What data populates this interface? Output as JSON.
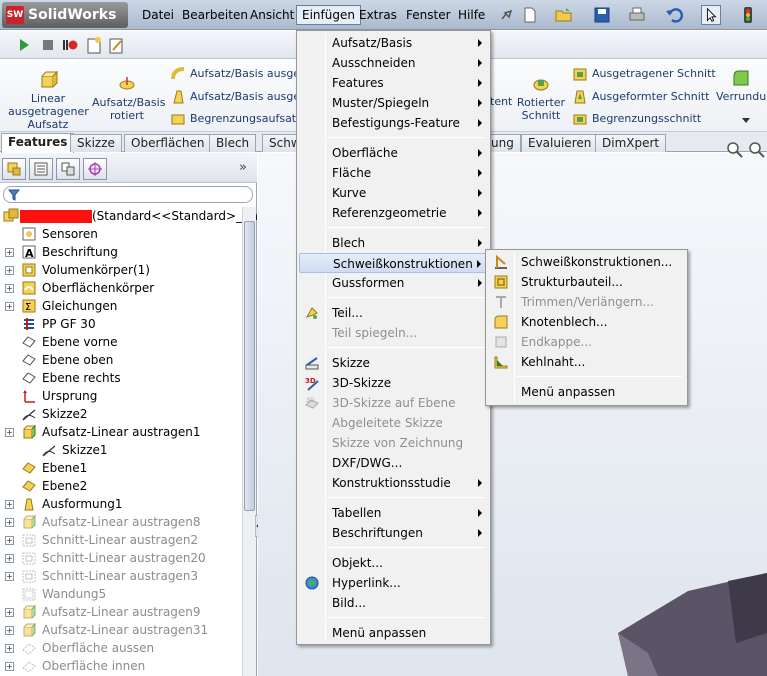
{
  "app": {
    "logo_text": "SolidWorks",
    "logo_mark": "SW"
  },
  "menubar": [
    "Datei",
    "Bearbeiten",
    "Ansicht",
    "Einfügen",
    "Extras",
    "Fenster",
    "Hilfe"
  ],
  "ribbon": {
    "big_buttons": [
      {
        "label": "Linear ausgetragener Aufsatz",
        "icon": "linear-extrude-boss-icon"
      },
      {
        "label": "Aufsatz/Basis rotiert",
        "icon": "revolve-boss-icon"
      },
      {
        "label": "Rotierter Schnitt",
        "icon": "revolve-cut-icon"
      },
      {
        "label": "Verrundung",
        "icon": "fillet-icon"
      }
    ],
    "small_buttons_left": [
      "Aufsatz/Basis ausgetr",
      "Aufsatz/Basis ausgefo",
      "Begrenzungsaufsatz/-"
    ],
    "small_buttons_right": [
      "Ausgetragener Schnitt",
      "Ausgeformter Schnitt",
      "Begrenzungsschnitt"
    ],
    "partial_label": "tent"
  },
  "tabs": [
    "Features",
    "Skizze",
    "Oberflächen",
    "Blech",
    "Schw",
    "ung",
    "Evaluieren",
    "DimXpert"
  ],
  "tree": {
    "root_label": "(Standard<<Standard>_Anz",
    "items": [
      {
        "label": "Sensoren",
        "icon": "sensor-icon",
        "expand": false,
        "dim": false
      },
      {
        "label": "Beschriftung",
        "icon": "annotation-icon",
        "expand": true,
        "dim": false
      },
      {
        "label": "Volumenkörper(1)",
        "icon": "solid-bodies-icon",
        "expand": true,
        "dim": false
      },
      {
        "label": "Oberflächenkörper",
        "icon": "surface-bodies-icon",
        "expand": true,
        "dim": false
      },
      {
        "label": "Gleichungen",
        "icon": "equations-icon",
        "expand": true,
        "dim": false
      },
      {
        "label": "PP GF 30",
        "icon": "material-icon",
        "expand": false,
        "dim": false
      },
      {
        "label": "Ebene vorne",
        "icon": "plane-icon",
        "expand": false,
        "dim": false
      },
      {
        "label": "Ebene oben",
        "icon": "plane-icon",
        "expand": false,
        "dim": false
      },
      {
        "label": "Ebene rechts",
        "icon": "plane-icon",
        "expand": false,
        "dim": false
      },
      {
        "label": "Ursprung",
        "icon": "origin-icon",
        "expand": false,
        "dim": false
      },
      {
        "label": "Skizze2",
        "icon": "sketch-icon",
        "expand": false,
        "dim": false
      },
      {
        "label": "Aufsatz-Linear austragen1",
        "icon": "extrude-icon",
        "expand": true,
        "dim": false
      },
      {
        "label": "Skizze1",
        "icon": "sketch-icon",
        "expand": false,
        "dim": false,
        "indent": true
      },
      {
        "label": "Ebene1",
        "icon": "ref-plane-icon",
        "expand": false,
        "dim": false
      },
      {
        "label": "Ebene2",
        "icon": "ref-plane-icon",
        "expand": false,
        "dim": false
      },
      {
        "label": "Ausformung1",
        "icon": "draft-icon",
        "expand": true,
        "dim": false
      },
      {
        "label": "Aufsatz-Linear austragen8",
        "icon": "extrude-icon",
        "expand": true,
        "dim": true
      },
      {
        "label": "Schnitt-Linear austragen2",
        "icon": "cut-extrude-icon",
        "expand": true,
        "dim": true
      },
      {
        "label": "Schnitt-Linear austragen20",
        "icon": "cut-extrude-icon",
        "expand": true,
        "dim": true
      },
      {
        "label": "Schnitt-Linear austragen3",
        "icon": "cut-extrude-icon",
        "expand": true,
        "dim": true
      },
      {
        "label": "Wandung5",
        "icon": "shell-icon",
        "expand": false,
        "dim": true
      },
      {
        "label": "Aufsatz-Linear austragen9",
        "icon": "extrude-icon",
        "expand": true,
        "dim": true
      },
      {
        "label": "Aufsatz-Linear austragen31",
        "icon": "extrude-icon",
        "expand": true,
        "dim": true
      },
      {
        "label": "Oberfläche aussen",
        "icon": "surface-icon",
        "expand": true,
        "dim": true
      },
      {
        "label": "Oberfläche innen",
        "icon": "surface-icon",
        "expand": true,
        "dim": true
      }
    ]
  },
  "einfuegen_menu": {
    "groups": [
      [
        {
          "label": "Aufsatz/Basis",
          "submenu": true
        },
        {
          "label": "Ausschneiden",
          "submenu": true
        },
        {
          "label": "Features",
          "submenu": true
        },
        {
          "label": "Muster/Spiegeln",
          "submenu": true
        },
        {
          "label": "Befestigungs-Feature",
          "submenu": true
        }
      ],
      [
        {
          "label": "Oberfläche",
          "submenu": true
        },
        {
          "label": "Fläche",
          "submenu": true
        },
        {
          "label": "Kurve",
          "submenu": true
        },
        {
          "label": "Referenzgeometrie",
          "submenu": true
        }
      ],
      [
        {
          "label": "Blech",
          "submenu": true
        },
        {
          "label": "Schweißkonstruktionen",
          "submenu": true,
          "highlighted": true
        },
        {
          "label": "Gussformen",
          "submenu": true
        }
      ],
      [
        {
          "label": "Teil...",
          "icon": "part-icon"
        },
        {
          "label": "Teil spiegeln...",
          "disabled": true
        }
      ],
      [
        {
          "label": "Skizze",
          "icon": "sketch-icon"
        },
        {
          "label": "3D-Skizze",
          "icon": "3d-sketch-icon"
        },
        {
          "label": "3D-Skizze auf Ebene",
          "icon": "3d-sketch-plane-icon",
          "disabled": true
        },
        {
          "label": "Abgeleitete Skizze",
          "disabled": true
        },
        {
          "label": "Skizze von Zeichnung",
          "disabled": true
        },
        {
          "label": "DXF/DWG..."
        },
        {
          "label": "Konstruktionsstudie",
          "submenu": true
        }
      ],
      [
        {
          "label": "Tabellen",
          "submenu": true
        },
        {
          "label": "Beschriftungen",
          "submenu": true
        }
      ],
      [
        {
          "label": "Objekt..."
        },
        {
          "label": "Hyperlink...",
          "icon": "globe-icon"
        },
        {
          "label": "Bild..."
        }
      ],
      [
        {
          "label": "Menü anpassen"
        }
      ]
    ]
  },
  "weld_submenu": {
    "items": [
      {
        "label": "Schweißkonstruktionen...",
        "icon": "weldment-icon"
      },
      {
        "label": "Strukturbauteil...",
        "icon": "structural-member-icon"
      },
      {
        "label": "Trimmen/Verlängern...",
        "icon": "trim-extend-icon",
        "disabled": true
      },
      {
        "label": "Knotenblech...",
        "icon": "gusset-icon"
      },
      {
        "label": "Endkappe...",
        "icon": "end-cap-icon",
        "disabled": true
      },
      {
        "label": "Kehlnaht...",
        "icon": "fillet-bead-icon"
      }
    ],
    "footer": "Menü anpassen"
  }
}
